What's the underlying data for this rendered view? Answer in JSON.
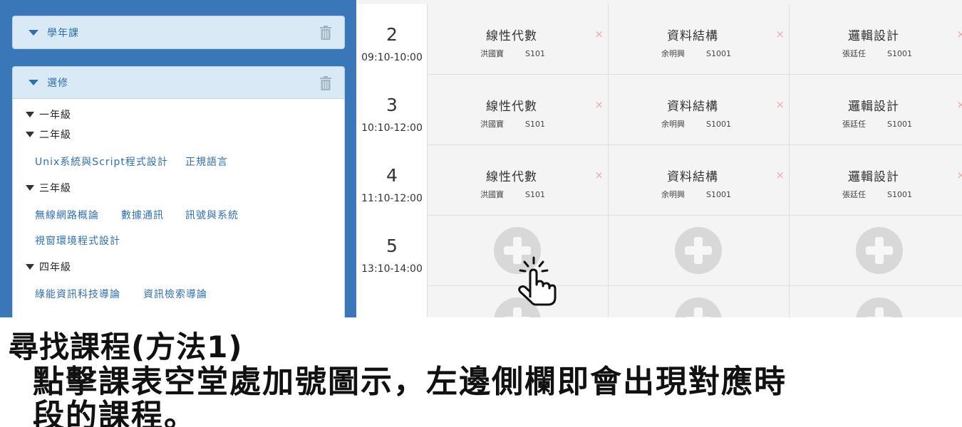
{
  "sidebar": {
    "panel1": {
      "title": "學年課",
      "icon": "trash-icon"
    },
    "panel2": {
      "title": "選修",
      "icon": "trash-icon",
      "grades": [
        {
          "label": "一年級",
          "courses": []
        },
        {
          "label": "二年級",
          "courses": [
            "Unix系統與Script程式設計",
            "正規語言"
          ]
        },
        {
          "label": "三年級",
          "courses": [
            "無線網路概論",
            "數據通訊",
            "訊號與系統",
            "視窗環境程式設計"
          ]
        },
        {
          "label": "四年級",
          "courses": [
            "綠能資訊科技導論",
            "資訊檢索導論"
          ]
        }
      ]
    }
  },
  "timetable": {
    "rows": [
      {
        "period": "2",
        "time": "09:10-10:00",
        "cells": [
          {
            "name": "線性代數",
            "teacher": "洪國寶",
            "room": "S101"
          },
          {
            "name": "資料結構",
            "teacher": "余明興",
            "room": "S1001"
          },
          {
            "name": "邏輯設計",
            "teacher": "張廷任",
            "room": "S1001"
          }
        ]
      },
      {
        "period": "3",
        "time": "10:10-12:00",
        "cells": [
          {
            "name": "線性代數",
            "teacher": "洪國寶",
            "room": "S101"
          },
          {
            "name": "資料結構",
            "teacher": "余明興",
            "room": "S1001"
          },
          {
            "name": "邏輯設計",
            "teacher": "張廷任",
            "room": "S1001"
          }
        ]
      },
      {
        "period": "4",
        "time": "11:10-12:00",
        "cells": [
          {
            "name": "線性代數",
            "teacher": "洪國寶",
            "room": "S101"
          },
          {
            "name": "資料結構",
            "teacher": "余明興",
            "room": "S1001"
          },
          {
            "name": "邏輯設計",
            "teacher": "張廷任",
            "room": "S1001"
          }
        ]
      },
      {
        "period": "5",
        "time": "13:10-14:00",
        "cells": [
          null,
          null,
          null
        ]
      }
    ],
    "remove_symbol": "×",
    "add_icon": "plus-circle-icon",
    "cursor_icon": "pointer-hand-icon"
  },
  "caption": {
    "line1": "尋找課程(方法1)",
    "line2": "點擊課表空堂處加號圖示，左邊側欄即會出現對應時",
    "line3": "段的課程。"
  },
  "colors": {
    "sidebar_bg": "#3a77b8",
    "panel_header_bg": "#d9eaf6",
    "link": "#2f6fb0",
    "remove_x": "#f0a9a9",
    "add_button": "#d8d8d8"
  }
}
